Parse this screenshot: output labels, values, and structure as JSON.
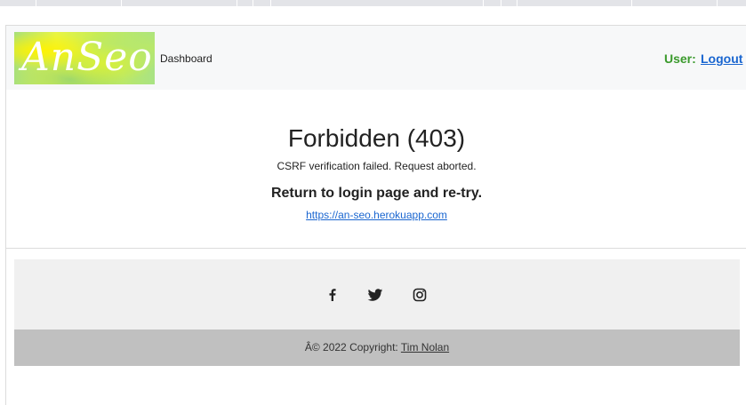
{
  "navbar": {
    "logo_text": "AnSeo",
    "dashboard_label": "Dashboard",
    "user_label": "User:",
    "logout_label": "Logout"
  },
  "error": {
    "title": "Forbidden (403)",
    "message": "CSRF verification failed. Request aborted.",
    "return_text": "Return to login page and re-try.",
    "link_text": "https://an-seo.herokuapp.com"
  },
  "footer": {
    "social_icons": [
      "facebook-icon",
      "twitter-icon",
      "instagram-icon"
    ],
    "copyright_prefix": "Â© 2022 Copyright: ",
    "copyright_name": "Tim Nolan"
  },
  "colors": {
    "navbar_bg": "#f7f8f9",
    "user_label": "#3a9a2c",
    "link": "#1a66d0",
    "footer_top_bg": "#f0f0f0",
    "footer_bottom_bg": "#c0c0c0"
  }
}
